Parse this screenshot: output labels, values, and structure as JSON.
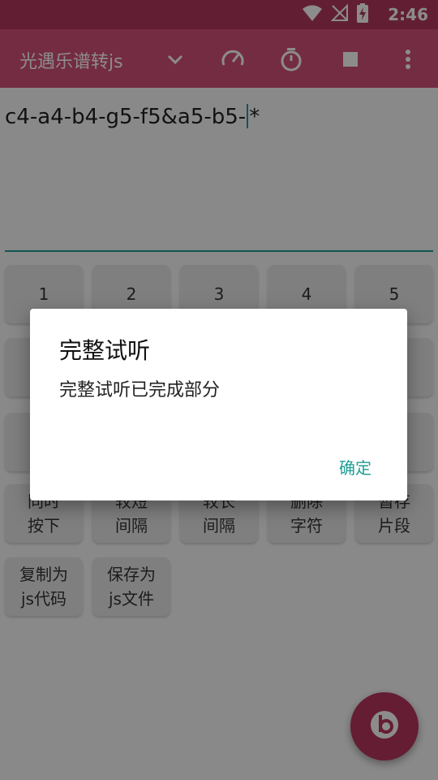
{
  "status_bar": {
    "time": "2:46",
    "icons": [
      "wifi-icon",
      "signal-off-icon",
      "battery-charging-icon"
    ]
  },
  "app_bar": {
    "title": "光遇乐谱转js",
    "icons": [
      "chevron-down-icon",
      "speed-gauge-icon",
      "stopwatch-icon",
      "stop-square-icon",
      "more-vertical-icon"
    ]
  },
  "editor": {
    "text_before_caret": "c4-a4-b4-g5-f5&a5-b5-",
    "text_after_caret": "*"
  },
  "keypad": {
    "row1": [
      "1",
      "2",
      "3",
      "4",
      "5"
    ],
    "row4": [
      [
        "同时",
        "按下"
      ],
      [
        "较短",
        "间隔"
      ],
      [
        "较长",
        "间隔"
      ],
      [
        "删除",
        "字符"
      ],
      [
        "暂存",
        "片段"
      ]
    ],
    "row5": [
      [
        "复制为",
        "js代码"
      ],
      [
        "保存为",
        "js文件"
      ]
    ]
  },
  "dialog": {
    "title": "完整试听",
    "message": "完整试听已完成部分",
    "confirm_label": "确定"
  },
  "colors": {
    "appbar": "#d4507a",
    "statusbar": "#b33a5f",
    "accent": "#1f9e96",
    "fab": "#b8365e"
  }
}
